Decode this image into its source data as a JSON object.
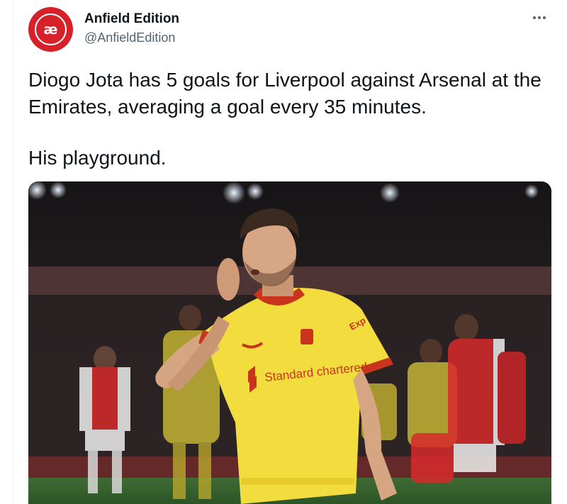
{
  "tweet": {
    "author": {
      "avatar_text": "æ",
      "display_name": "Anfield Edition",
      "handle": "@AnfieldEdition"
    },
    "more_icon": "more-horizontal-icon",
    "text_lines": [
      "Diogo Jota has 5 goals for Liverpool against Arsenal at the Emirates, averaging a goal every 35 minutes.",
      "His playground."
    ],
    "image": {
      "shirt_sponsor": "Standard chartered",
      "shirt_sleeve": "Exp"
    }
  },
  "colors": {
    "avatar_red": "#d6202a",
    "text_primary": "#0f1419",
    "text_secondary": "#536471",
    "kit_yellow": "#f2dc3e",
    "kit_trim": "#c8351c",
    "arsenal_red": "#d72a2a"
  }
}
